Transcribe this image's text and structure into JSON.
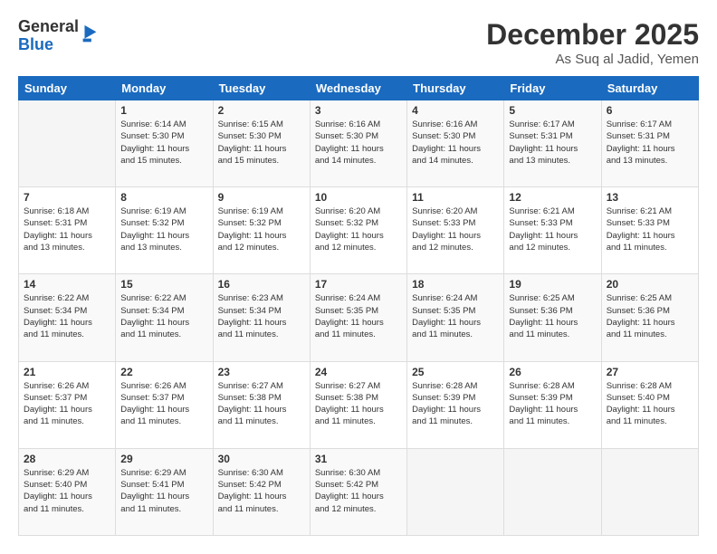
{
  "logo": {
    "general": "General",
    "blue": "Blue"
  },
  "header": {
    "month": "December 2025",
    "location": "As Suq al Jadid, Yemen"
  },
  "days_of_week": [
    "Sunday",
    "Monday",
    "Tuesday",
    "Wednesday",
    "Thursday",
    "Friday",
    "Saturday"
  ],
  "weeks": [
    [
      {
        "day": "",
        "info": ""
      },
      {
        "day": "1",
        "info": "Sunrise: 6:14 AM\nSunset: 5:30 PM\nDaylight: 11 hours\nand 15 minutes."
      },
      {
        "day": "2",
        "info": "Sunrise: 6:15 AM\nSunset: 5:30 PM\nDaylight: 11 hours\nand 15 minutes."
      },
      {
        "day": "3",
        "info": "Sunrise: 6:16 AM\nSunset: 5:30 PM\nDaylight: 11 hours\nand 14 minutes."
      },
      {
        "day": "4",
        "info": "Sunrise: 6:16 AM\nSunset: 5:30 PM\nDaylight: 11 hours\nand 14 minutes."
      },
      {
        "day": "5",
        "info": "Sunrise: 6:17 AM\nSunset: 5:31 PM\nDaylight: 11 hours\nand 13 minutes."
      },
      {
        "day": "6",
        "info": "Sunrise: 6:17 AM\nSunset: 5:31 PM\nDaylight: 11 hours\nand 13 minutes."
      }
    ],
    [
      {
        "day": "7",
        "info": "Sunrise: 6:18 AM\nSunset: 5:31 PM\nDaylight: 11 hours\nand 13 minutes."
      },
      {
        "day": "8",
        "info": "Sunrise: 6:19 AM\nSunset: 5:32 PM\nDaylight: 11 hours\nand 13 minutes."
      },
      {
        "day": "9",
        "info": "Sunrise: 6:19 AM\nSunset: 5:32 PM\nDaylight: 11 hours\nand 12 minutes."
      },
      {
        "day": "10",
        "info": "Sunrise: 6:20 AM\nSunset: 5:32 PM\nDaylight: 11 hours\nand 12 minutes."
      },
      {
        "day": "11",
        "info": "Sunrise: 6:20 AM\nSunset: 5:33 PM\nDaylight: 11 hours\nand 12 minutes."
      },
      {
        "day": "12",
        "info": "Sunrise: 6:21 AM\nSunset: 5:33 PM\nDaylight: 11 hours\nand 12 minutes."
      },
      {
        "day": "13",
        "info": "Sunrise: 6:21 AM\nSunset: 5:33 PM\nDaylight: 11 hours\nand 11 minutes."
      }
    ],
    [
      {
        "day": "14",
        "info": "Sunrise: 6:22 AM\nSunset: 5:34 PM\nDaylight: 11 hours\nand 11 minutes."
      },
      {
        "day": "15",
        "info": "Sunrise: 6:22 AM\nSunset: 5:34 PM\nDaylight: 11 hours\nand 11 minutes."
      },
      {
        "day": "16",
        "info": "Sunrise: 6:23 AM\nSunset: 5:34 PM\nDaylight: 11 hours\nand 11 minutes."
      },
      {
        "day": "17",
        "info": "Sunrise: 6:24 AM\nSunset: 5:35 PM\nDaylight: 11 hours\nand 11 minutes."
      },
      {
        "day": "18",
        "info": "Sunrise: 6:24 AM\nSunset: 5:35 PM\nDaylight: 11 hours\nand 11 minutes."
      },
      {
        "day": "19",
        "info": "Sunrise: 6:25 AM\nSunset: 5:36 PM\nDaylight: 11 hours\nand 11 minutes."
      },
      {
        "day": "20",
        "info": "Sunrise: 6:25 AM\nSunset: 5:36 PM\nDaylight: 11 hours\nand 11 minutes."
      }
    ],
    [
      {
        "day": "21",
        "info": "Sunrise: 6:26 AM\nSunset: 5:37 PM\nDaylight: 11 hours\nand 11 minutes."
      },
      {
        "day": "22",
        "info": "Sunrise: 6:26 AM\nSunset: 5:37 PM\nDaylight: 11 hours\nand 11 minutes."
      },
      {
        "day": "23",
        "info": "Sunrise: 6:27 AM\nSunset: 5:38 PM\nDaylight: 11 hours\nand 11 minutes."
      },
      {
        "day": "24",
        "info": "Sunrise: 6:27 AM\nSunset: 5:38 PM\nDaylight: 11 hours\nand 11 minutes."
      },
      {
        "day": "25",
        "info": "Sunrise: 6:28 AM\nSunset: 5:39 PM\nDaylight: 11 hours\nand 11 minutes."
      },
      {
        "day": "26",
        "info": "Sunrise: 6:28 AM\nSunset: 5:39 PM\nDaylight: 11 hours\nand 11 minutes."
      },
      {
        "day": "27",
        "info": "Sunrise: 6:28 AM\nSunset: 5:40 PM\nDaylight: 11 hours\nand 11 minutes."
      }
    ],
    [
      {
        "day": "28",
        "info": "Sunrise: 6:29 AM\nSunset: 5:40 PM\nDaylight: 11 hours\nand 11 minutes."
      },
      {
        "day": "29",
        "info": "Sunrise: 6:29 AM\nSunset: 5:41 PM\nDaylight: 11 hours\nand 11 minutes."
      },
      {
        "day": "30",
        "info": "Sunrise: 6:30 AM\nSunset: 5:42 PM\nDaylight: 11 hours\nand 11 minutes."
      },
      {
        "day": "31",
        "info": "Sunrise: 6:30 AM\nSunset: 5:42 PM\nDaylight: 11 hours\nand 12 minutes."
      },
      {
        "day": "",
        "info": ""
      },
      {
        "day": "",
        "info": ""
      },
      {
        "day": "",
        "info": ""
      }
    ]
  ]
}
